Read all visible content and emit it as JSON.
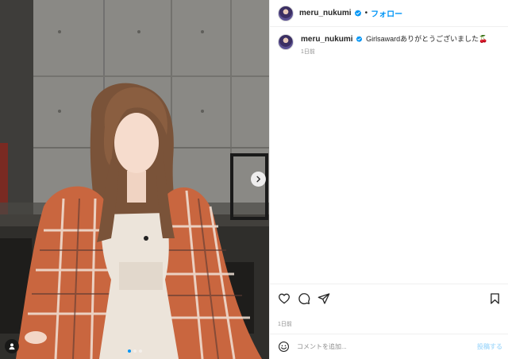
{
  "post": {
    "username": "meru_nukumi",
    "follow_label": "フォロー",
    "separator": "•",
    "caption": "Girlsawardありがとうございました🍒",
    "caption_time": "1日前",
    "post_time": "1日前"
  },
  "comment_box": {
    "placeholder": "コメントを追加...",
    "post_label": "投稿する"
  },
  "carousel": {
    "slides": 3,
    "active_index": 0
  },
  "icons": {
    "verified": "verified-badge-icon",
    "next": "chevron-right-icon",
    "tag": "user-tag-icon",
    "like": "heart-icon",
    "comment": "comment-icon",
    "share": "paper-plane-icon",
    "save": "bookmark-icon",
    "emoji": "smiley-icon"
  },
  "colors": {
    "accent": "#0095f6",
    "text": "#262626",
    "muted": "#8e8e8e",
    "post_disabled": "#b2dffc"
  }
}
